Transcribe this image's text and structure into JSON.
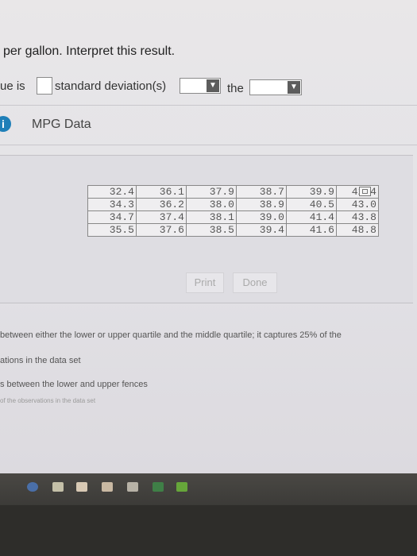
{
  "question": {
    "line": "per gallon. Interpret this result."
  },
  "answer_row": {
    "prefix": "ue is",
    "middle": "standard deviation(s)",
    "connector": "the",
    "dropdown_arrow": "▼"
  },
  "info_icon_glyph": "i",
  "mpg_title": "MPG Data",
  "table": {
    "rows": [
      [
        "32.4",
        "36.1",
        "37.9",
        "38.7",
        "39.9",
        "42.4"
      ],
      [
        "34.3",
        "36.2",
        "38.0",
        "38.9",
        "40.5",
        "43.0"
      ],
      [
        "34.7",
        "37.4",
        "38.1",
        "39.0",
        "41.4",
        "43.8"
      ],
      [
        "35.5",
        "37.6",
        "38.5",
        "39.4",
        "41.6",
        "48.8"
      ]
    ]
  },
  "buttons": {
    "print": "Print",
    "done": "Done"
  },
  "options": {
    "line1": "between either the lower or upper quartile and the middle quartile; it captures 25% of the",
    "line2": "ations in the data set",
    "line3": "s between the lower and upper fences",
    "line4": "of the observations in the data set"
  },
  "colors": {
    "info_blue": "#1f7fb8",
    "dropdown_dark": "#5d5d5d"
  }
}
